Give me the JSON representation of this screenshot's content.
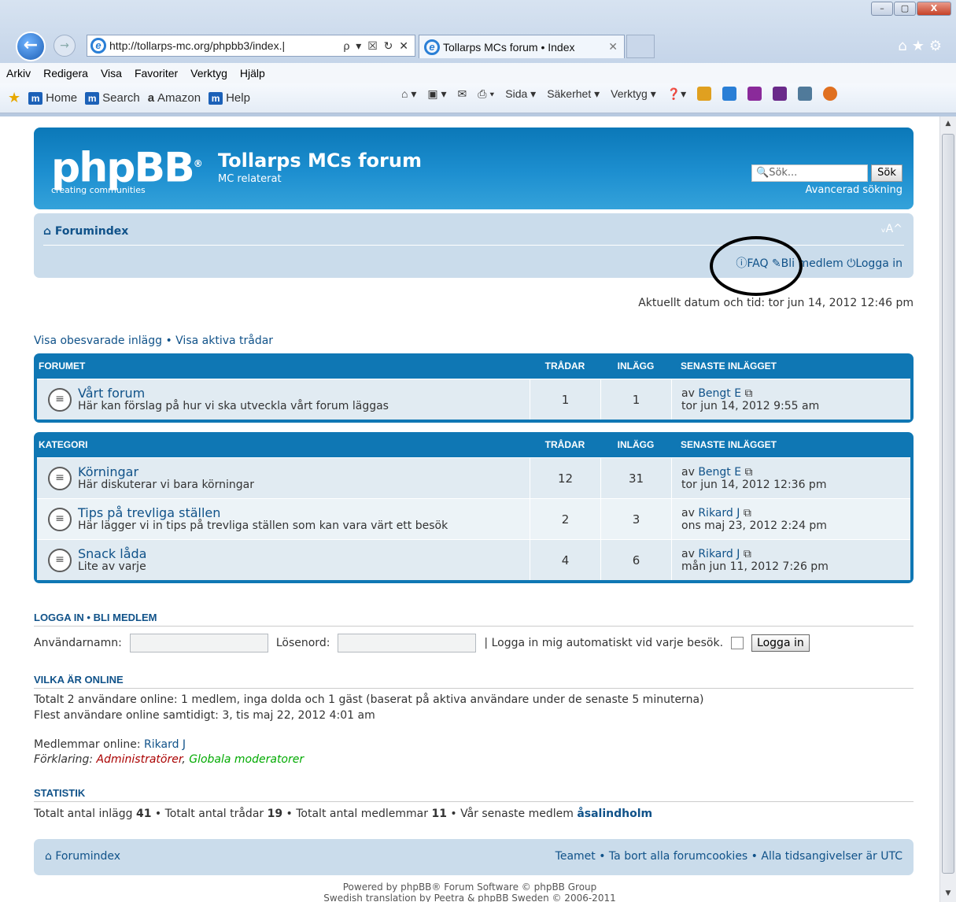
{
  "browser": {
    "url": "http://tollarps-mc.org/phpbb3/index.|",
    "url_controls": "ρ ▾ ☒ ↻ ✕",
    "tab_title": "Tollarps MCs forum • Index",
    "tab_close": "✕",
    "menu": [
      "Arkiv",
      "Redigera",
      "Visa",
      "Favoriter",
      "Verktyg",
      "Hjälp"
    ],
    "favorites": [
      {
        "label": "Home",
        "icon": "m-icon"
      },
      {
        "label": "Search",
        "icon": "m-icon"
      },
      {
        "label": "Amazon",
        "icon": "amazon-icon"
      },
      {
        "label": "Help",
        "icon": "m-icon"
      }
    ],
    "commands": [
      "Sida ▾",
      "Säkerhet ▾",
      "Verktyg ▾"
    ],
    "window_controls": [
      "–",
      "▢",
      "X"
    ]
  },
  "header": {
    "logo_text": "phpBB",
    "logo_reg": "®",
    "logo_tagline": "creating  communities",
    "site_title": "Tollarps MCs forum",
    "site_desc": "MC relaterat",
    "search_placeholder": "Sök...",
    "search_button": "Sök",
    "advanced_search": "Avancerad sökning"
  },
  "navbar": {
    "breadcrumb": "Forumindex",
    "font_size": "ᵥA^",
    "faq": "FAQ",
    "register": "Bli medlem",
    "login": "Logga in"
  },
  "datetime": "Aktuellt datum och tid: tor jun 14, 2012 12:46 pm",
  "quicklinks": "Visa obesvarade inlägg • Visa aktiva trådar",
  "categories": [
    {
      "name": "FORUMET",
      "col_topics": "TRÅDAR",
      "col_posts": "INLÄGG",
      "col_last": "SENASTE INLÄGGET",
      "forums": [
        {
          "title": "Vårt forum",
          "desc": "Här kan förslag på hur vi ska utveckla vårt forum läggas",
          "topics": "1",
          "posts": "1",
          "last_by": "av",
          "last_user": "Bengt E",
          "last_time": "tor jun 14, 2012 9:55 am"
        }
      ]
    },
    {
      "name": "KATEGORI",
      "col_topics": "TRÅDAR",
      "col_posts": "INLÄGG",
      "col_last": "SENASTE INLÄGGET",
      "forums": [
        {
          "title": "Körningar",
          "desc": "Här diskuterar vi bara körningar",
          "topics": "12",
          "posts": "31",
          "last_by": "av",
          "last_user": "Bengt E",
          "last_time": "tor jun 14, 2012 12:36 pm"
        },
        {
          "title": "Tips på trevliga ställen",
          "desc": "Här lägger vi in tips på trevliga ställen som kan vara värt ett besök",
          "topics": "2",
          "posts": "3",
          "last_by": "av",
          "last_user": "Rikard J",
          "last_time": "ons maj 23, 2012 2:24 pm"
        },
        {
          "title": "Snack låda",
          "desc": "Lite av varje",
          "topics": "4",
          "posts": "6",
          "last_by": "av",
          "last_user": "Rikard J",
          "last_time": "mån jun 11, 2012 7:26 pm"
        }
      ]
    }
  ],
  "login": {
    "heading": "LOGGA IN  •  BLI MEDLEM",
    "username_label": "Användarnamn:",
    "password_label": "Lösenord:",
    "auto_label": "| Logga in mig automatiskt vid varje besök.",
    "button": "Logga in"
  },
  "online": {
    "heading": "VILKA ÄR ONLINE",
    "line1": "Totalt 2 användare online: 1 medlem, inga dolda och 1 gäst (baserat på aktiva användare under de senaste 5 minuterna)",
    "line2": "Flest användare online samtidigt: 3, tis maj 22, 2012 4:01 am",
    "members_label": "Medlemmar online:",
    "members_user": "Rikard J",
    "legend_label": "Förklaring:",
    "legend_admins": "Administratörer",
    "legend_comma": ",",
    "legend_mods": "Globala moderatorer"
  },
  "stats": {
    "heading": "STATISTIK",
    "p1": "Totalt antal inlägg",
    "v1": "41",
    "p2": "• Totalt antal trådar",
    "v2": "19",
    "p3": "• Totalt antal medlemmar",
    "v3": "11",
    "p4": "• Vår senaste medlem",
    "v4": "åsalindholm"
  },
  "footer": {
    "breadcrumb": "Forumindex",
    "links": "Teamet • Ta bort alla forumcookies • Alla tidsangivelser är UTC",
    "powered1": "Powered by phpBB® Forum Software © phpBB Group",
    "powered2": "Swedish translation by Peetra & phpBB Sweden © 2006-2011"
  }
}
